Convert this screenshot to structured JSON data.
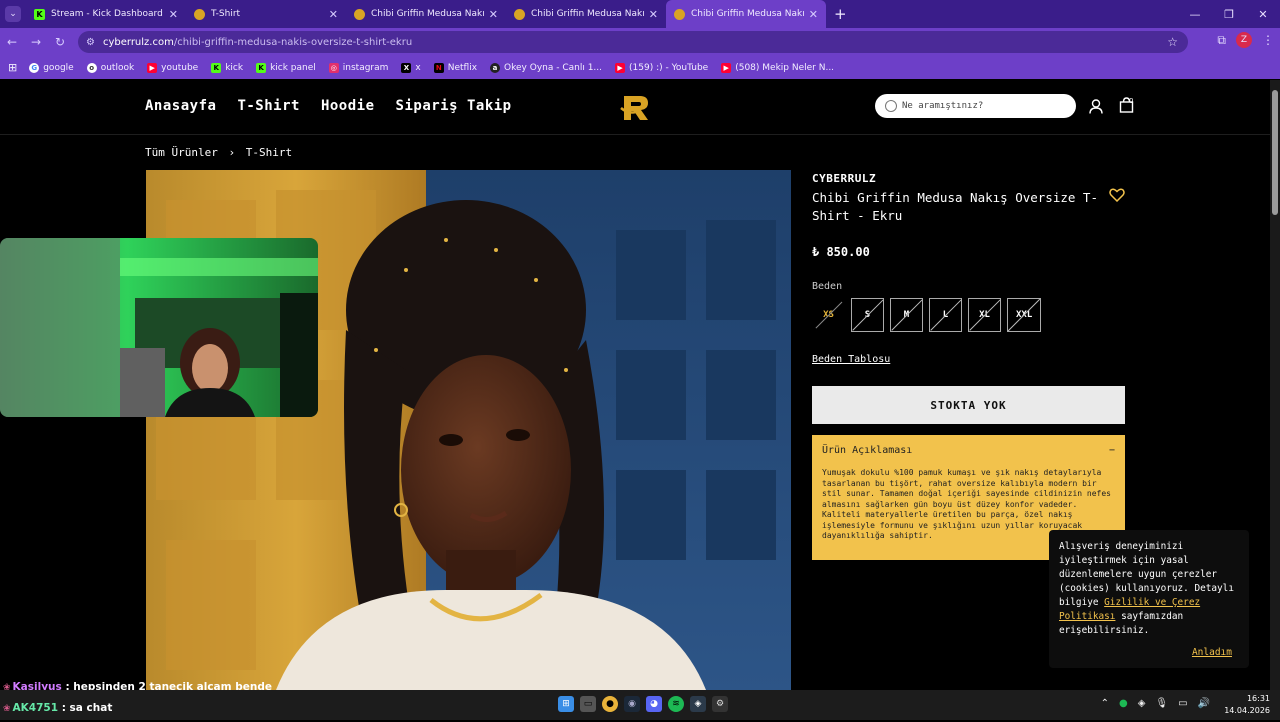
{
  "browser": {
    "tabs": [
      {
        "title": "Stream - Kick Dashboard",
        "icon": "kick-icon",
        "active": false
      },
      {
        "title": "T-Shirt",
        "icon": "cyberrulz-icon",
        "active": false
      },
      {
        "title": "Chibi Griffin Medusa Nakış Overs",
        "icon": "cyberrulz-icon",
        "active": false
      },
      {
        "title": "Chibi Griffin Medusa Nakış Overs",
        "icon": "cyberrulz-icon",
        "active": false
      },
      {
        "title": "Chibi Griffin Medusa Nakış Overs",
        "icon": "cyberrulz-icon",
        "active": true
      }
    ],
    "url_host": "cyberrulz.com",
    "url_path": "/chibi-griffin-medusa-nakis-oversize-t-shirt-ekru",
    "profile_initial": "Z",
    "bookmarks": [
      {
        "label": "google",
        "icon": "G"
      },
      {
        "label": "outlook",
        "icon": "o"
      },
      {
        "label": "youtube",
        "icon": "▶"
      },
      {
        "label": "kick",
        "icon": "K"
      },
      {
        "label": "kick panel",
        "icon": "K"
      },
      {
        "label": "instagram",
        "icon": "◎"
      },
      {
        "label": "x",
        "icon": "X"
      },
      {
        "label": "Netflix",
        "icon": "N"
      },
      {
        "label": "Okey Oyna - Canlı 1...",
        "icon": "a"
      },
      {
        "label": "(159) :) - YouTube",
        "icon": "▶"
      },
      {
        "label": "(508) Mekip Neler N...",
        "icon": "▶"
      }
    ]
  },
  "site": {
    "nav": [
      "Anasayfa",
      "T-Shirt",
      "Hoodie",
      "Sipariş Takip"
    ],
    "search_placeholder": "Ne aramıştınız?",
    "cart_count": "0",
    "breadcrumb": {
      "root": "Tüm Ürünler",
      "sep": "›",
      "current": "T-Shirt"
    }
  },
  "product": {
    "brand": "CYBERRULZ",
    "title": "Chibi Griffin Medusa Nakış Oversize T-Shirt - Ekru",
    "price": "₺ 850.00",
    "size_label": "Beden",
    "sizes": [
      "XS",
      "S",
      "M",
      "L",
      "XL",
      "XXL"
    ],
    "size_table_link": "Beden Tablosu",
    "stock_button": "STOKTA YOK",
    "description_title": "Ürün Açıklaması",
    "description_toggle": "−",
    "description": "Yumuşak dokulu %100 pamuk kumaşı ve şık nakış detaylarıyla tasarlanan bu tişört, rahat oversize kalıbıyla modern bir stil sunar. Tamamen doğal içeriği sayesinde cildinizin nefes almasını sağlarken gün boyu üst düzey konfor vadeder. Kaliteli materyallerle üretilen bu parça, özel nakış işlemesiyle formunu ve şıklığını uzun yıllar koruyacak dayanıklılığa sahiptir."
  },
  "cookie": {
    "text_before": "Alışveriş deneyiminizi iyileştirmek için yasal düzenlemelere uygun çerezler (cookies) kullanıyoruz. Detaylı bilgiye ",
    "link": "Gizlilik ve Çerez Politikası",
    "text_after": " sayfamızdan erişebilirsiniz.",
    "accept": "Anladım"
  },
  "chat": [
    {
      "user": "Kasilyus",
      "message": ": hepsinden 2 tanecik alcam bende"
    },
    {
      "user": "AK4751",
      "message": ": sa chat"
    }
  ],
  "taskbar": {
    "time": "16:31",
    "date": "14.04.2026"
  }
}
